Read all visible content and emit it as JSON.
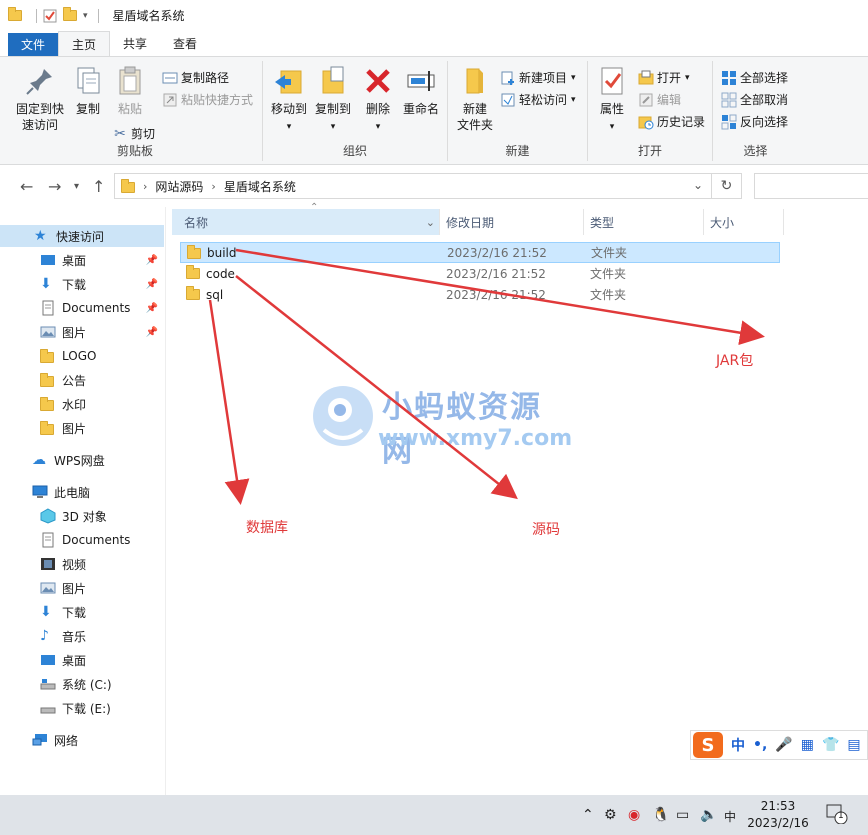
{
  "window": {
    "title": "星盾域名系统"
  },
  "ribbon_tabs": [
    "文件",
    "主页",
    "共享",
    "查看"
  ],
  "ribbon": {
    "clipboard": {
      "pin_label_1": "固定到快",
      "pin_label_2": "速访问",
      "copy": "复制",
      "paste": "粘贴",
      "copy_path": "复制路径",
      "paste_shortcut": "粘贴快捷方式",
      "cut": "剪切",
      "group": "剪贴板"
    },
    "organize": {
      "move_to": "移动到",
      "copy_to": "复制到",
      "delete": "删除",
      "rename": "重命名",
      "group": "组织"
    },
    "new": {
      "new_folder_1": "新建",
      "new_folder_2": "文件夹",
      "new_item": "新建项目",
      "easy_access": "轻松访问",
      "group": "新建"
    },
    "open": {
      "properties": "属性",
      "open": "打开",
      "edit": "编辑",
      "history": "历史记录",
      "group": "打开"
    },
    "select": {
      "select_all": "全部选择",
      "select_none": "全部取消",
      "invert": "反向选择",
      "group": "选择"
    }
  },
  "address": {
    "crumbs": [
      "网站源码",
      "星盾域名系统"
    ]
  },
  "sidebar": {
    "quick_access": "快速访问",
    "quick_items": [
      "桌面",
      "下载",
      "Documents",
      "图片",
      "LOGO",
      "公告",
      "水印",
      "图片"
    ],
    "wps": "WPS网盘",
    "this_pc": "此电脑",
    "pc_items": [
      "3D 对象",
      "Documents",
      "视频",
      "图片",
      "下载",
      "音乐",
      "桌面",
      "系统 (C:)",
      "下载 (E:)"
    ],
    "network": "网络"
  },
  "columns": {
    "name": "名称",
    "date": "修改日期",
    "type": "类型",
    "size": "大小"
  },
  "files": [
    {
      "name": "build",
      "date": "2023/2/16 21:52",
      "type": "文件夹"
    },
    {
      "name": "code",
      "date": "2023/2/16 21:52",
      "type": "文件夹"
    },
    {
      "name": "sql",
      "date": "2023/2/16 21:52",
      "type": "文件夹"
    }
  ],
  "annotations": {
    "jar": "JAR包",
    "db": "数据库",
    "src": "源码"
  },
  "watermark": {
    "title": "小蚂蚁资源网",
    "url": "www.xmy7.com"
  },
  "ime": {
    "logo": "S",
    "lang": "中",
    "punct": "•,"
  },
  "taskbar": {
    "ime_indicator": "中",
    "time": "21:53",
    "date": "2023/2/16",
    "notifications": "1"
  },
  "colors": {
    "accent": "#1f6dbf",
    "annotation": "#e0393a",
    "selection": "#cce8ff",
    "folder": "#f5c84c"
  }
}
